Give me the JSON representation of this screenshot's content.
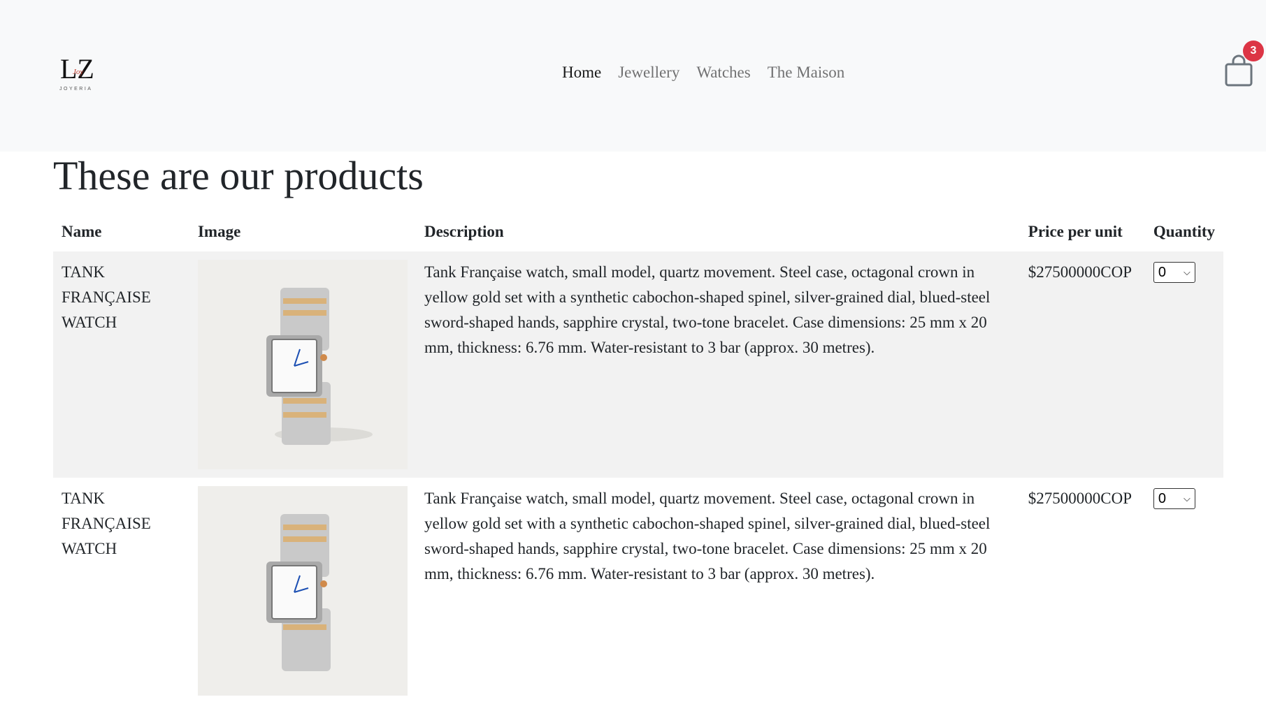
{
  "brand": {
    "logo_letters": "LZ",
    "logo_script": "Joy",
    "logo_subtitle": "JOYERIA",
    "badge_color": "#dc3545"
  },
  "nav": {
    "items": [
      {
        "label": "Home",
        "active": true
      },
      {
        "label": "Jewellery",
        "active": false
      },
      {
        "label": "Watches",
        "active": false
      },
      {
        "label": "The Maison",
        "active": false
      }
    ]
  },
  "cart": {
    "icon": "shopping-bag-icon",
    "count": "3"
  },
  "page": {
    "title": "These are our products"
  },
  "table": {
    "headers": {
      "name": "Name",
      "image": "Image",
      "description": "Description",
      "price": "Price per unit",
      "quantity": "Quantity"
    },
    "rows": [
      {
        "name": "TANK FRANÇAISE WATCH",
        "image_alt": "watch-image",
        "description": "Tank Française watch, small model, quartz movement. Steel case, octagonal crown in yellow gold set with a synthetic cabochon-shaped spinel, silver-grained dial, blued-steel sword-shaped hands, sapphire crystal, two-tone bracelet. Case dimensions: 25 mm x 20 mm, thickness: 6.76 mm. Water-resistant to 3 bar (approx. 30 metres).",
        "price": "$27500000COP",
        "quantity": "0"
      },
      {
        "name": "TANK FRANÇAISE WATCH",
        "image_alt": "watch-image",
        "description": "Tank Française watch, small model, quartz movement. Steel case, octagonal crown in yellow gold set with a synthetic cabochon-shaped spinel, silver-grained dial, blued-steel sword-shaped hands, sapphire crystal, two-tone bracelet. Case dimensions: 25 mm x 20 mm, thickness: 6.76 mm. Water-resistant to 3 bar (approx. 30 metres).",
        "price": "$27500000COP",
        "quantity": "0"
      }
    ]
  }
}
